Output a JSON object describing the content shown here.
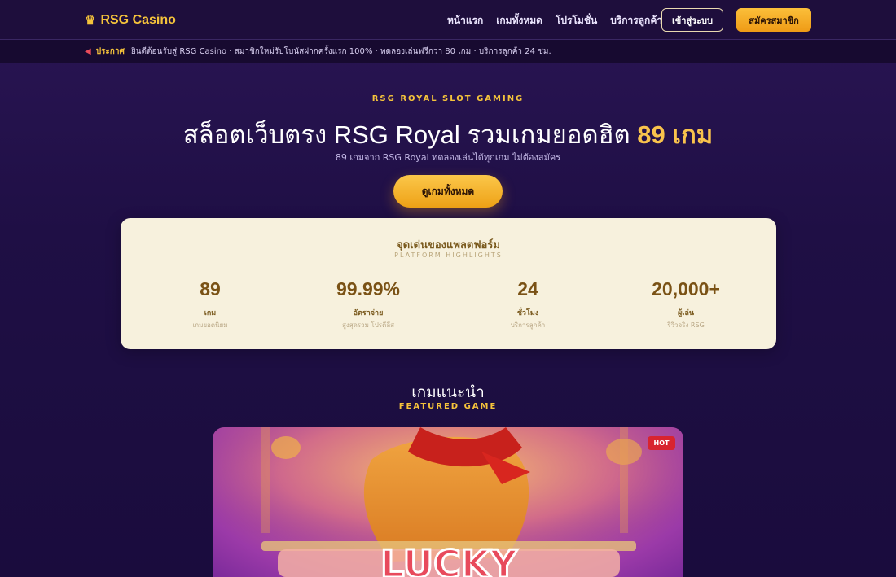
{
  "header": {
    "logo_text": "RSG Casino",
    "logo_icon": "crown-icon",
    "nav": [
      "หน้าแรก",
      "เกมทั้งหมด",
      "โปรโมชั่น",
      "บริการลูกค้า"
    ],
    "login_label": "เข้าสู่ระบบ",
    "register_label": "สมัครสมาชิก"
  },
  "announcement": {
    "icon": "megaphone-icon",
    "label": "ประกาศ",
    "text": "ยินดีต้อนรับสู่ RSG Casino · สมาชิกใหม่รับโบนัสฝากครั้งแรก 100% · ทดลองเล่นฟรีกว่า 80 เกม · บริการลูกค้า 24 ชม."
  },
  "hero": {
    "eyebrow": "RSG ROYAL SLOT GAMING",
    "title_main": "สล็อตเว็บตรง RSG Royal รวมเกมยอดฮิต",
    "title_highlight": "89 เกม",
    "subtitle": "89 เกมจาก RSG Royal ทดลองเล่นได้ทุกเกม ไม่ต้องสมัคร",
    "cta_label": "ดูเกมทั้งหมด"
  },
  "highlights": {
    "title": "จุดเด่นของแพลตฟอร์ม",
    "subtitle": "PLATFORM HIGHLIGHTS",
    "stats": [
      {
        "value": "89",
        "label": "เกม",
        "desc": "เกมยอดนิยม"
      },
      {
        "value": "99.99%",
        "label": "อัตราจ่าย",
        "desc": "สูงสุดรวม โปรดีลีส"
      },
      {
        "value": "24",
        "label": "ชั่วโมง",
        "desc": "บริการลูกค้า"
      },
      {
        "value": "20,000+",
        "label": "ผู้เล่น",
        "desc": "รีวิวจริง RSG"
      }
    ]
  },
  "featured": {
    "title": "เกมแนะนำ",
    "subtitle": "FEATURED GAME",
    "badge": "HOT"
  },
  "colors": {
    "accent": "#f5c33b",
    "background": "#1f0f45",
    "card": "#f7f1dd",
    "badge": "#d8242f"
  }
}
